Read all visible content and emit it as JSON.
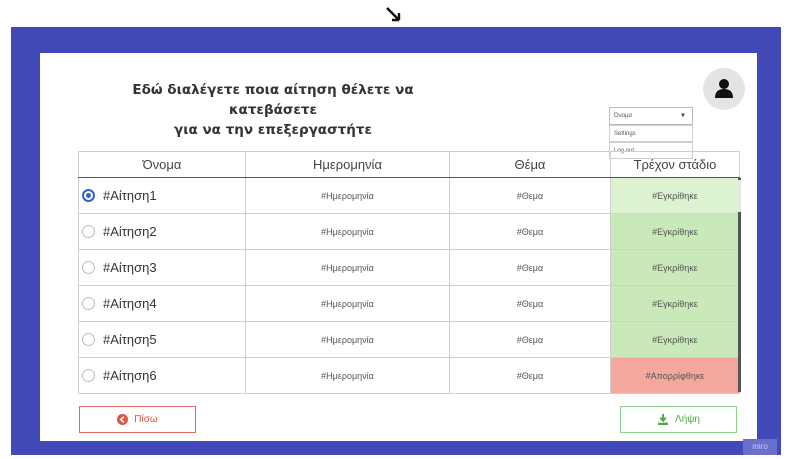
{
  "page": {
    "title_line1": "Εδώ διαλέγετε ποια αίτηση θέλετε να κατεβάσετε",
    "title_line2": "για να την επεξεργαστήτε"
  },
  "user_menu": {
    "selected": "Όνομα",
    "items": [
      "Settings",
      "Log out"
    ]
  },
  "table": {
    "headers": [
      "Όνομα",
      "Ημερομηνία",
      "Θέμα",
      "Τρέχον στάδιο"
    ],
    "rows": [
      {
        "name": "#Αίτηση1",
        "date": "#Ημερομηνία",
        "subject": "#Θεμα",
        "status": "#Εγκρίθηκε",
        "selected": true
      },
      {
        "name": "#Αίτηση2",
        "date": "#Ημερομηνία",
        "subject": "#Θεμα",
        "status": "#Εγκρίθηκε",
        "selected": false
      },
      {
        "name": "#Αίτηση3",
        "date": "#Ημερομηνία",
        "subject": "#Θεμα",
        "status": "#Εγκρίθηκε",
        "selected": false
      },
      {
        "name": "#Αίτηση4",
        "date": "#Ημερομηνία",
        "subject": "#Θεμα",
        "status": "#Εγκρίθηκε",
        "selected": false
      },
      {
        "name": "#Αίτηση5",
        "date": "#Ημερομηνία",
        "subject": "#Θεμα",
        "status": "#Εγκρίθηκε",
        "selected": false
      },
      {
        "name": "#Αίτηση6",
        "date": "#Ημερομηνία",
        "subject": "#Θεμα",
        "status": "#Απορρίφθηκε",
        "selected": false
      }
    ]
  },
  "buttons": {
    "back_label": "Πίσω",
    "download_label": "Λήψη"
  },
  "watermark": "miro",
  "colors": {
    "frame": "#4249b8",
    "approved": "#c9eab8",
    "rejected": "#f4a79c",
    "back": "#e05244",
    "download": "#4aa943",
    "radio_selected": "#2f5fd0"
  },
  "icons": {
    "cursor": "arrow-cursor-icon",
    "avatar": "user-avatar-icon",
    "back": "arrow-left-circle-icon",
    "download": "download-icon",
    "dropdown": "caret-down-icon"
  }
}
